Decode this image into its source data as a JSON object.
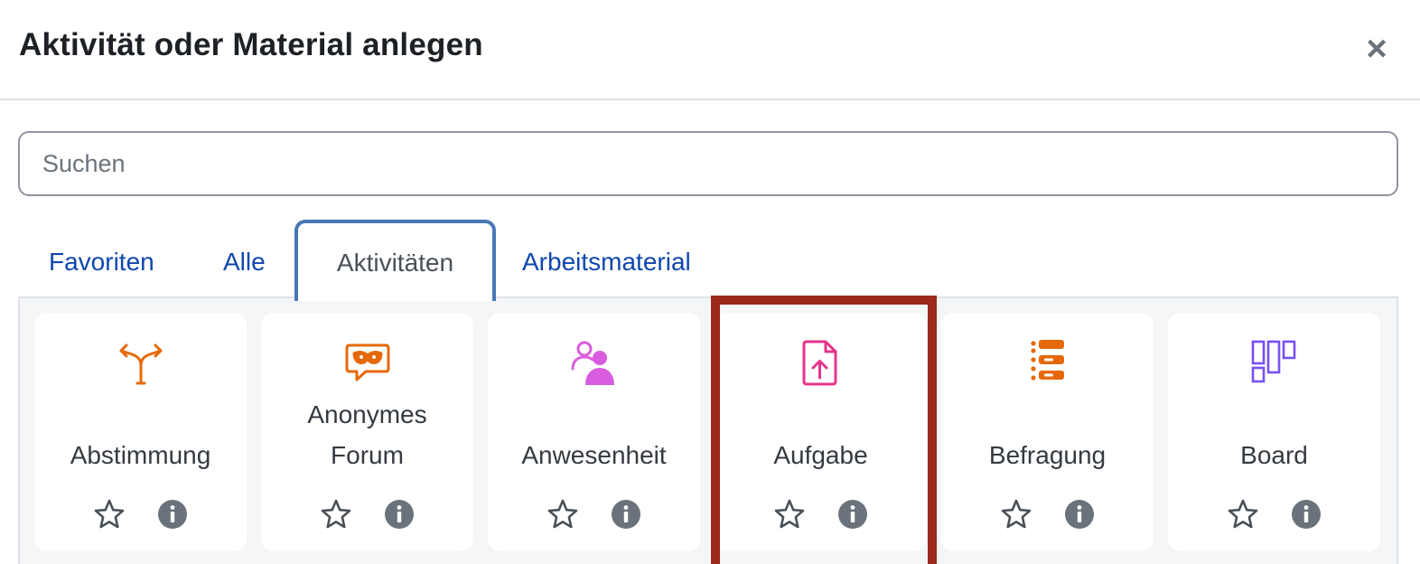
{
  "dialog": {
    "title": "Aktivität oder Material anlegen",
    "close_symbol": "×"
  },
  "search": {
    "placeholder": "Suchen",
    "value": ""
  },
  "tabs": [
    {
      "label": "Favoriten",
      "active": false
    },
    {
      "label": "Alle",
      "active": false
    },
    {
      "label": "Aktivitäten",
      "active": true
    },
    {
      "label": "Arbeitsmaterial",
      "active": false
    }
  ],
  "modules": [
    {
      "label_lines": [
        "Abstimmung"
      ],
      "icon": "choice-icon",
      "icon_color": "#e5690a"
    },
    {
      "label_lines": [
        "Anonymes",
        "Forum"
      ],
      "icon": "anonymous-forum-icon",
      "icon_color": "#e5690a"
    },
    {
      "label_lines": [
        "Anwesenheit"
      ],
      "icon": "attendance-icon",
      "icon_color": "#d85dde"
    },
    {
      "label_lines": [
        "Aufgabe"
      ],
      "icon": "assignment-upload-icon",
      "icon_color": "#e6358c",
      "highlighted": true
    },
    {
      "label_lines": [
        "Befragung"
      ],
      "icon": "feedback-list-icon",
      "icon_color": "#e5690a"
    },
    {
      "label_lines": [
        "Board"
      ],
      "icon": "board-icon",
      "icon_color": "#7950f2"
    }
  ],
  "colors": {
    "link": "#0f47ad",
    "active_tab_border": "#4a77b4",
    "highlight_border": "#9b2a1c",
    "grid_background": "#f5f6f8",
    "info_icon": "#6a737b"
  }
}
